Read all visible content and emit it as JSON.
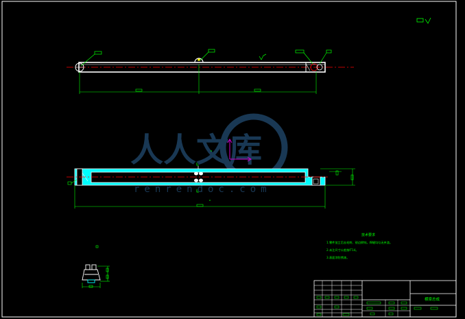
{
  "notes": {
    "title": "技术要求",
    "lines": [
      "1.零件加工后去毛刺、锐边倒钝，焊缝均匀无夹渣。",
      "2.未注尺寸公差按IT14。",
      "3.表面涂防锈漆。"
    ]
  },
  "title_block": {
    "drawing_name": "横梁总成"
  },
  "watermark": {
    "text": "人人文库",
    "url": "renrendoc.com"
  },
  "colors": {
    "background": "#000000",
    "outline": "#ffffff",
    "dimension": "#00ff00",
    "centerline": "#ff0000",
    "section_fill": "#00ffff",
    "ucs_icon": "#cc00cc"
  }
}
